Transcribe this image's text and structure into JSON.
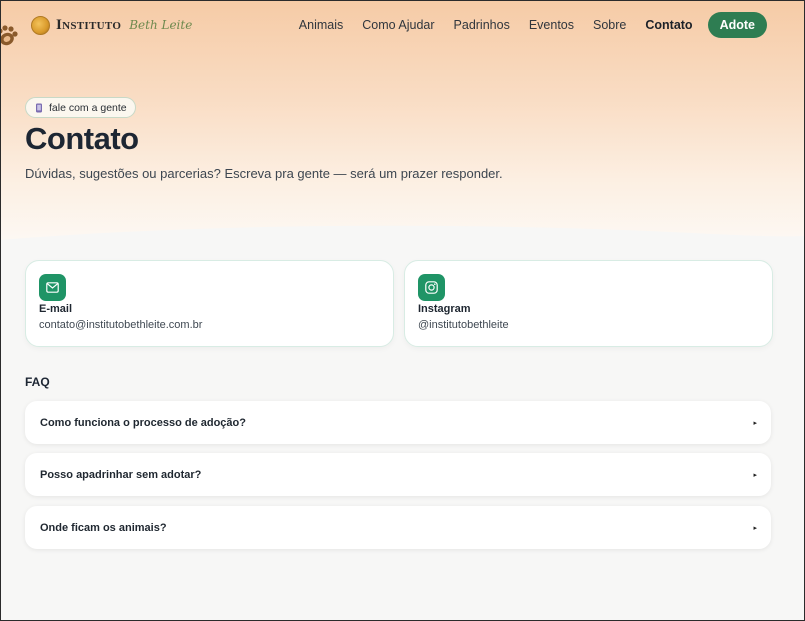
{
  "brand": {
    "name": "Instituto",
    "sub": "Beth Leite"
  },
  "nav": {
    "links": [
      "Animais",
      "Como Ajudar",
      "Padrinhos",
      "Eventos",
      "Sobre",
      "Contato"
    ],
    "active": "Contato",
    "cta": "Adote"
  },
  "hero": {
    "pill": "fale com a gente",
    "title": "Contato",
    "subtitle": "Dúvidas, sugestões ou parcerias? Escreva pra gente — será um prazer responder."
  },
  "contacts": {
    "email": {
      "label": "E-mail",
      "value": "contato@institutobethleite.com.br",
      "icon": "mail-icon"
    },
    "instagram": {
      "label": "Instagram",
      "value": "@institutobethleite",
      "icon": "instagram-icon"
    }
  },
  "faq": {
    "title": "FAQ",
    "items": [
      {
        "question": "Como funciona o processo de adoção?"
      },
      {
        "question": "Posso apadrinhar sem adotar?"
      },
      {
        "question": "Onde ficam os animais?"
      }
    ],
    "arrow": "▸"
  },
  "colors": {
    "accent": "#2e7d52",
    "icon_bg": "#1f9466",
    "hero_top": "#f6cba6",
    "page_bg": "#f7f7f6"
  }
}
